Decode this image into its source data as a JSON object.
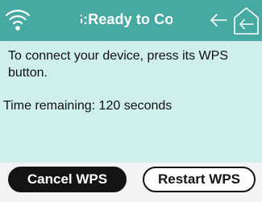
{
  "header": {
    "title": "S:Ready to Co"
  },
  "message": {
    "instruction": "To connect your device, press its WPS button.",
    "time_remaining": "Time remaining: 120 seconds"
  },
  "buttons": {
    "cancel_label": "Cancel WPS",
    "restart_label": "Restart WPS"
  },
  "icons": {
    "status": "wifi-icon",
    "back": "back-arrow-icon",
    "home": "home-back-icon"
  },
  "colors": {
    "header_bg": "#47aaa2",
    "content_bg": "#cfefed",
    "footer_bg": "#f1f3f5",
    "button_dark": "#141414"
  }
}
